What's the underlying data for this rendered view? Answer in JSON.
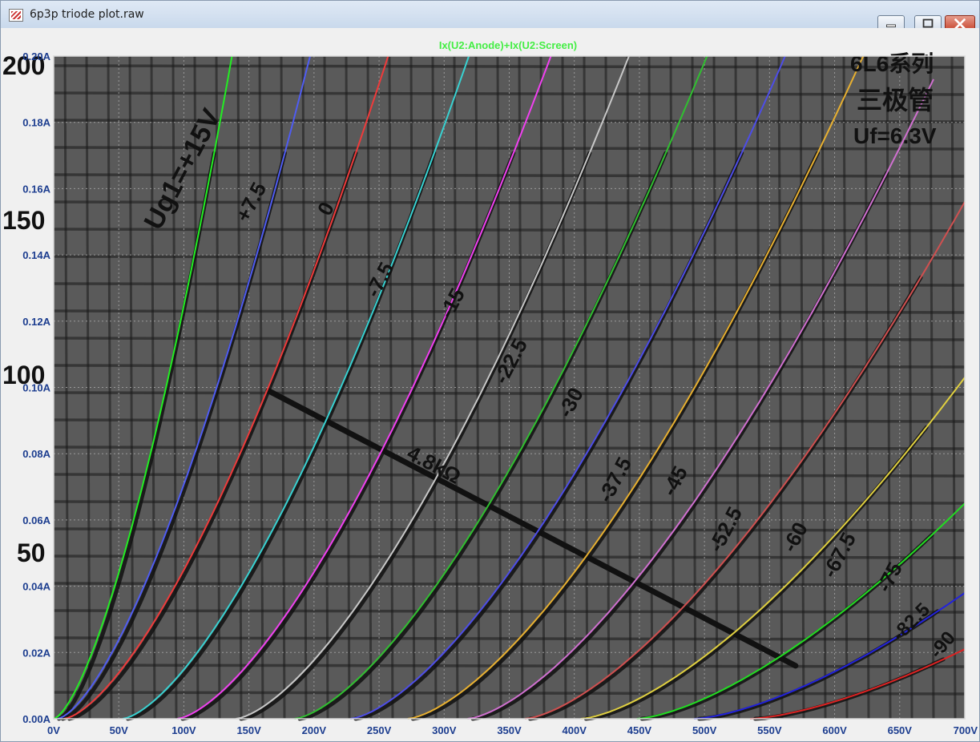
{
  "window": {
    "title": "6p3p triode plot.raw",
    "controls": [
      "minimize",
      "maximize",
      "close"
    ]
  },
  "chart_data": {
    "type": "line",
    "title": "Ix(U2:Anode)+Ix(U2:Screen)",
    "title_color": "#44ee44",
    "background": "#5a5a5a",
    "grid": true,
    "xlim": [
      0,
      700
    ],
    "ylim": [
      0,
      0.2
    ],
    "x_ticks": [
      "0V",
      "50V",
      "100V",
      "150V",
      "200V",
      "250V",
      "300V",
      "350V",
      "400V",
      "450V",
      "500V",
      "550V",
      "600V",
      "650V",
      "700V"
    ],
    "y_ticks": [
      "0.00A",
      "0.02A",
      "0.04A",
      "0.06A",
      "0.08A",
      "0.10A",
      "0.12A",
      "0.14A",
      "0.16A",
      "0.18A",
      "0.20A"
    ],
    "series": [
      {
        "color": "#22ee22",
        "x0": 0,
        "x_end": 137,
        "y_end": 0.2
      },
      {
        "color": "#4f5cf2",
        "x0": 3,
        "x_end": 197,
        "y_end": 0.2
      },
      {
        "color": "#f03a3a",
        "x0": 8,
        "x_end": 257,
        "y_end": 0.2
      },
      {
        "color": "#38d2d2",
        "x0": 53,
        "x_end": 319,
        "y_end": 0.2
      },
      {
        "color": "#f040f0",
        "x0": 95,
        "x_end": 382,
        "y_end": 0.2
      },
      {
        "color": "#c8c8c8",
        "x0": 140,
        "x_end": 442,
        "y_end": 0.2
      },
      {
        "color": "#30c030",
        "x0": 185,
        "x_end": 502,
        "y_end": 0.2
      },
      {
        "color": "#4d4de8",
        "x0": 228,
        "x_end": 562,
        "y_end": 0.2
      },
      {
        "color": "#e8b030",
        "x0": 272,
        "x_end": 622,
        "y_end": 0.2
      },
      {
        "color": "#d070d0",
        "x0": 318,
        "x_end": 676,
        "y_end": 0.193
      },
      {
        "color": "#d05050",
        "x0": 362,
        "x_end": 700,
        "y_end": 0.156
      },
      {
        "color": "#e0d040",
        "x0": 405,
        "x_end": 700,
        "y_end": 0.103
      },
      {
        "color": "#22dd22",
        "x0": 448,
        "x_end": 700,
        "y_end": 0.065
      },
      {
        "color": "#2222dd",
        "x0": 492,
        "x_end": 700,
        "y_end": 0.038
      },
      {
        "color": "#dd2222",
        "x0": 535,
        "x_end": 700,
        "y_end": 0.021
      }
    ],
    "overlay": {
      "labels": [
        "Ug1=+15V",
        "+7.5",
        "0",
        "-7.5",
        "-15",
        "-22.5",
        "-30",
        "-37.5",
        "-45",
        "-52.5",
        "-60",
        "-67.5",
        "-75",
        "-82.5",
        "-90"
      ],
      "load_line_label": "4.8kΩ",
      "side_ticks": [
        "200",
        "150",
        "100",
        "50"
      ],
      "corner_text": [
        "6L6系列",
        "三极管",
        "Uf=6.3V"
      ],
      "load_line": [
        [
          165,
          0.099
        ],
        [
          570,
          0.016
        ]
      ]
    }
  }
}
